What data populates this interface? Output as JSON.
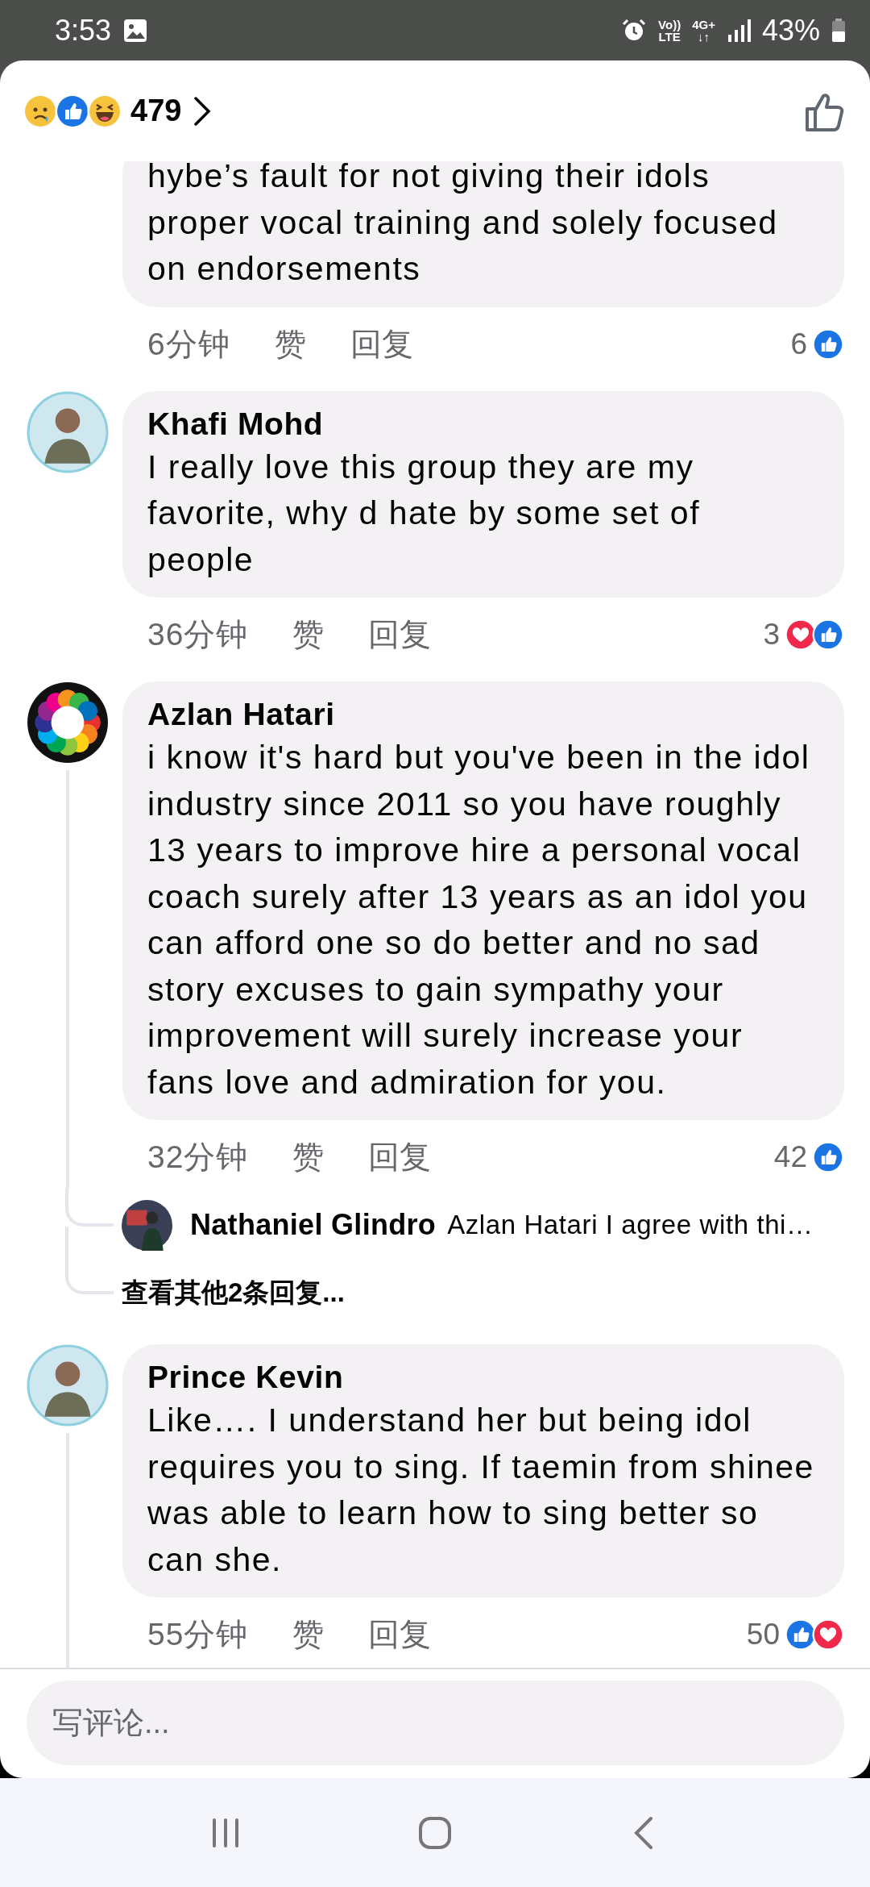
{
  "status_bar": {
    "time": "3:53",
    "volte_top": "Vo))",
    "volte_bottom": "LTE",
    "network": "4G+",
    "network_arrows": "↓↑",
    "battery": "43%"
  },
  "header": {
    "reactions": [
      {
        "kind": "sad"
      },
      {
        "kind": "like"
      },
      {
        "kind": "haha"
      }
    ],
    "count": "479"
  },
  "comments": [
    {
      "text": "hybe’s fault for not giving their idols proper vocal training and solely focused on endorsements",
      "time": "6分钟",
      "like_label": "赞",
      "reply_label": "回复",
      "reaction_count": "6",
      "reactions": [
        {
          "kind": "like"
        }
      ],
      "thread": false
    },
    {
      "author": "Khafi Mohd",
      "text": "I really love this group they are my favorite, why d hate by some set of people",
      "time": "36分钟",
      "like_label": "赞",
      "reply_label": "回复",
      "reaction_count": "3",
      "reactions": [
        {
          "kind": "love"
        },
        {
          "kind": "like"
        }
      ],
      "thread": false,
      "avatar": {
        "kind": "person"
      }
    },
    {
      "author": "Azlan Hatari",
      "text": "i know it's hard but you've been in the idol industry since 2011 so you have roughly 13 years to improve hire a personal vocal coach surely after 13 years as an idol you can afford one so do better and no sad story excuses to gain sympathy your improvement will surely increase your fans love and admiration for you.",
      "time": "32分钟",
      "like_label": "赞",
      "reply_label": "回复",
      "reaction_count": "42",
      "reactions": [
        {
          "kind": "like"
        }
      ],
      "thread": true,
      "avatar": {
        "kind": "flower"
      },
      "replies": [
        {
          "author": "Nathaniel Glindro",
          "text": "Azlan Hatari I agree with thi…"
        }
      ],
      "more_replies": "查看其他2条回复..."
    },
    {
      "author": "Prince Kevin",
      "text": "Like…. I understand her but being idol requires you to sing. If taemin from shinee was able to learn how to sing better so can she.",
      "time": "55分钟",
      "like_label": "赞",
      "reply_label": "回复",
      "reaction_count": "50",
      "reactions": [
        {
          "kind": "like"
        },
        {
          "kind": "love"
        }
      ],
      "thread": true,
      "avatar": {
        "kind": "person"
      }
    }
  ],
  "composer": {
    "placeholder": "写评论..."
  }
}
